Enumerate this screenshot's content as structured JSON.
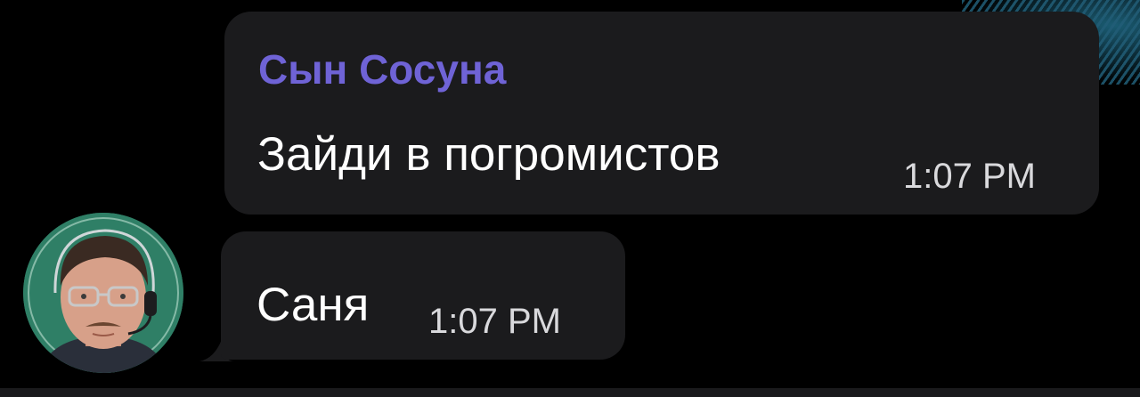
{
  "messages": [
    {
      "sender": "Сын Сосуна",
      "text": "Зайди в погромистов",
      "time": "1:07 PM"
    },
    {
      "text": "Саня",
      "time": "1:07 PM"
    }
  ],
  "colors": {
    "background": "#000000",
    "bubble": "#1b1b1d",
    "sender_name": "#6f63d6",
    "text": "#ffffff",
    "time": "#d9d9dc"
  },
  "icons": {
    "avatar": "user-avatar-photo"
  }
}
